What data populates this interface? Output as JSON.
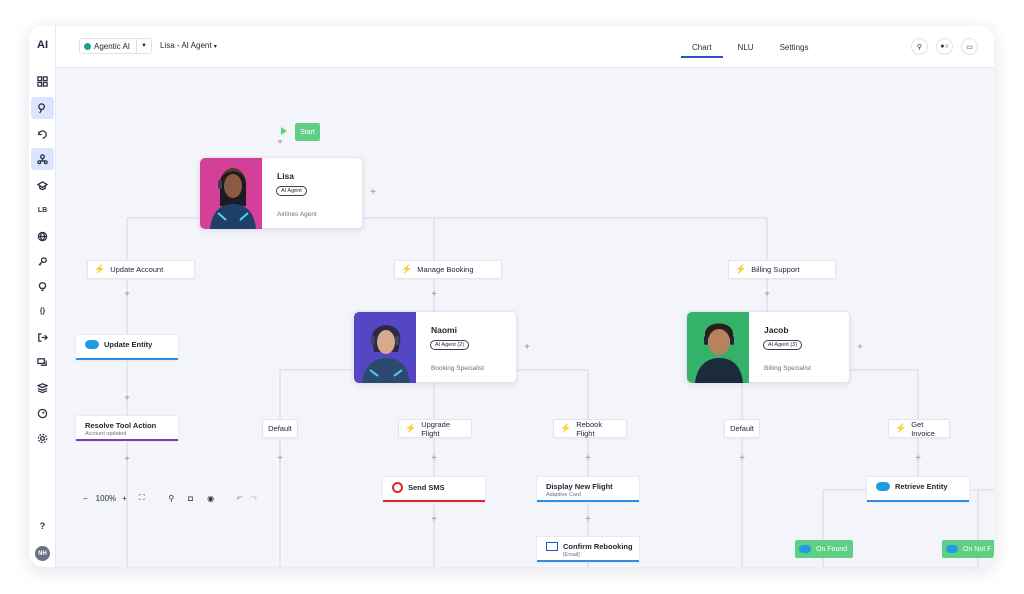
{
  "app": {
    "logo": "AI"
  },
  "workspace": {
    "name": "Agentic AI",
    "dot_color": "#14a58f"
  },
  "agent_selector": {
    "label": "Lisa - AI Agent"
  },
  "tabs": [
    {
      "label": "Chart",
      "active": true
    },
    {
      "label": "NLU"
    },
    {
      "label": "Settings"
    }
  ],
  "sidebar": {
    "items": [
      {
        "icon": "grid-icon"
      },
      {
        "icon": "route-icon",
        "active": true
      },
      {
        "icon": "cycle-icon"
      },
      {
        "icon": "org-chart-icon",
        "active": true
      },
      {
        "icon": "graduation-cap-icon"
      },
      {
        "icon": "lb-icon",
        "text": "LB"
      },
      {
        "icon": "globe-icon"
      },
      {
        "icon": "key-icon"
      },
      {
        "icon": "lightbulb-icon"
      },
      {
        "icon": "braces-icon",
        "text": "{}"
      },
      {
        "icon": "exit-icon"
      },
      {
        "icon": "chat-icon"
      },
      {
        "icon": "layers-icon"
      },
      {
        "icon": "gauge-icon"
      },
      {
        "icon": "gear-icon"
      }
    ],
    "help": "?",
    "user_initials": "NH"
  },
  "flow": {
    "start": "Start",
    "lisa": {
      "name": "Lisa",
      "badge": "AI Agent",
      "role": "Airlines Agent",
      "color": "#d43f98"
    },
    "naomi": {
      "name": "Naomi",
      "badge": "AI Agent (2)",
      "role": "Booking Specialist",
      "color": "#5446c4"
    },
    "jacob": {
      "name": "Jacob",
      "badge": "AI Agent (3)",
      "role": "Billing Specialist",
      "color": "#34b26a"
    },
    "triggers": {
      "update_account": "Update Account",
      "manage_booking": "Manage Booking",
      "billing_support": "Billing Support",
      "upgrade_flight": "Upgrade Flight",
      "rebook_flight": "Rebook Flight",
      "get_invoice": "Get Invoice",
      "default1": "Default",
      "default2": "Default"
    },
    "tools": {
      "update_entity": {
        "title": "Update Entity",
        "color": "#2d8ee6"
      },
      "resolve_tool": {
        "title": "Resolve Tool Action",
        "subtitle": "Account updated",
        "color": "#7a3fb8"
      },
      "send_sms": {
        "title": "Send SMS",
        "color": "#e0262f"
      },
      "display_flight": {
        "title": "Display New Flight",
        "subtitle": "Adaptive Card",
        "color": "#2d8ee6"
      },
      "confirm_rebooking": {
        "title": "Confirm Rebooking",
        "subtitle": "[Email]",
        "color": "#2d8ee6"
      },
      "retrieve_entity": {
        "title": "Retrieve Entity",
        "color": "#2d8ee6"
      }
    },
    "outcomes": {
      "on_found": "On Found",
      "on_not_found": "On Not F"
    }
  },
  "toolbar_bottom": {
    "zoom": "100%"
  }
}
